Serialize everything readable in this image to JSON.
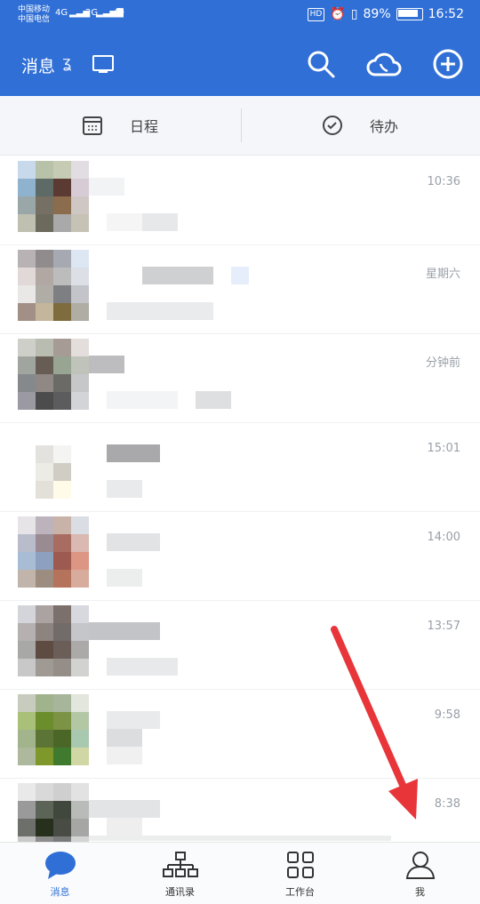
{
  "status_bar": {
    "carrier1": "中国移动",
    "carrier2": "中国电信",
    "net1": "4G",
    "net2": "2G",
    "hd": "HD",
    "battery": "89%",
    "time": "16:52"
  },
  "app_bar": {
    "title": "消息"
  },
  "tabs": [
    {
      "label": "日程"
    },
    {
      "label": "待办"
    }
  ],
  "messages": [
    {
      "time": "10:36"
    },
    {
      "time": "星期六"
    },
    {
      "time": "分钟前"
    },
    {
      "time": "15:01"
    },
    {
      "time": "14:00"
    },
    {
      "time": "13:57"
    },
    {
      "time": "9:58"
    },
    {
      "time": "8:38"
    }
  ],
  "bottom_nav": [
    {
      "label": "消息",
      "active": true
    },
    {
      "label": "通讯录"
    },
    {
      "label": "工作台"
    },
    {
      "label": "我"
    }
  ],
  "colors": {
    "brand": "#2f6fd6",
    "annotation_arrow": "#e8353a"
  }
}
